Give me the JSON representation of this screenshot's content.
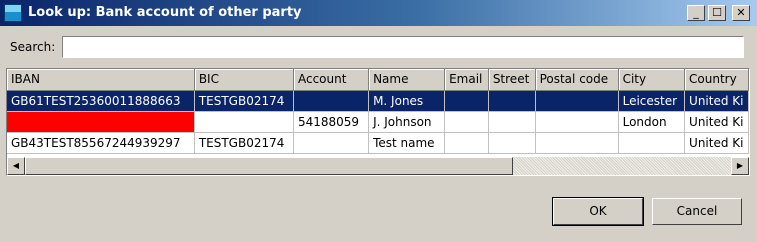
{
  "window": {
    "title": "Look up: Bank account of other party",
    "minimize_glyph": "_",
    "maximize_glyph": "☐",
    "close_glyph": "✕",
    "icon": "app-icon"
  },
  "search": {
    "label": "Search:",
    "value": "",
    "placeholder": ""
  },
  "table": {
    "columns": [
      "IBAN",
      "BIC",
      "Account",
      "Name",
      "Email",
      "Street",
      "Postal code",
      "City",
      "Country"
    ],
    "rows": [
      {
        "selected": true,
        "flag": false,
        "cells": [
          "GB61TEST25360011888663",
          "TESTGB02174",
          "",
          "M. Jones",
          "",
          "",
          "",
          "Leicester",
          "United Ki"
        ]
      },
      {
        "selected": false,
        "flag": true,
        "cells": [
          "",
          "",
          "54188059",
          "J. Johnson",
          "",
          "",
          "",
          "London",
          "United Ki"
        ]
      },
      {
        "selected": false,
        "flag": false,
        "cells": [
          "GB43TEST85567244939297",
          "TESTGB02174",
          "",
          "Test name",
          "",
          "",
          "",
          "",
          "United Ki"
        ]
      }
    ],
    "flag_color": "#ff0000",
    "selection_color": "#0a246a"
  },
  "scrollbar": {
    "left_glyph": "◀",
    "right_glyph": "▶"
  },
  "buttons": {
    "ok": "OK",
    "cancel": "Cancel"
  }
}
